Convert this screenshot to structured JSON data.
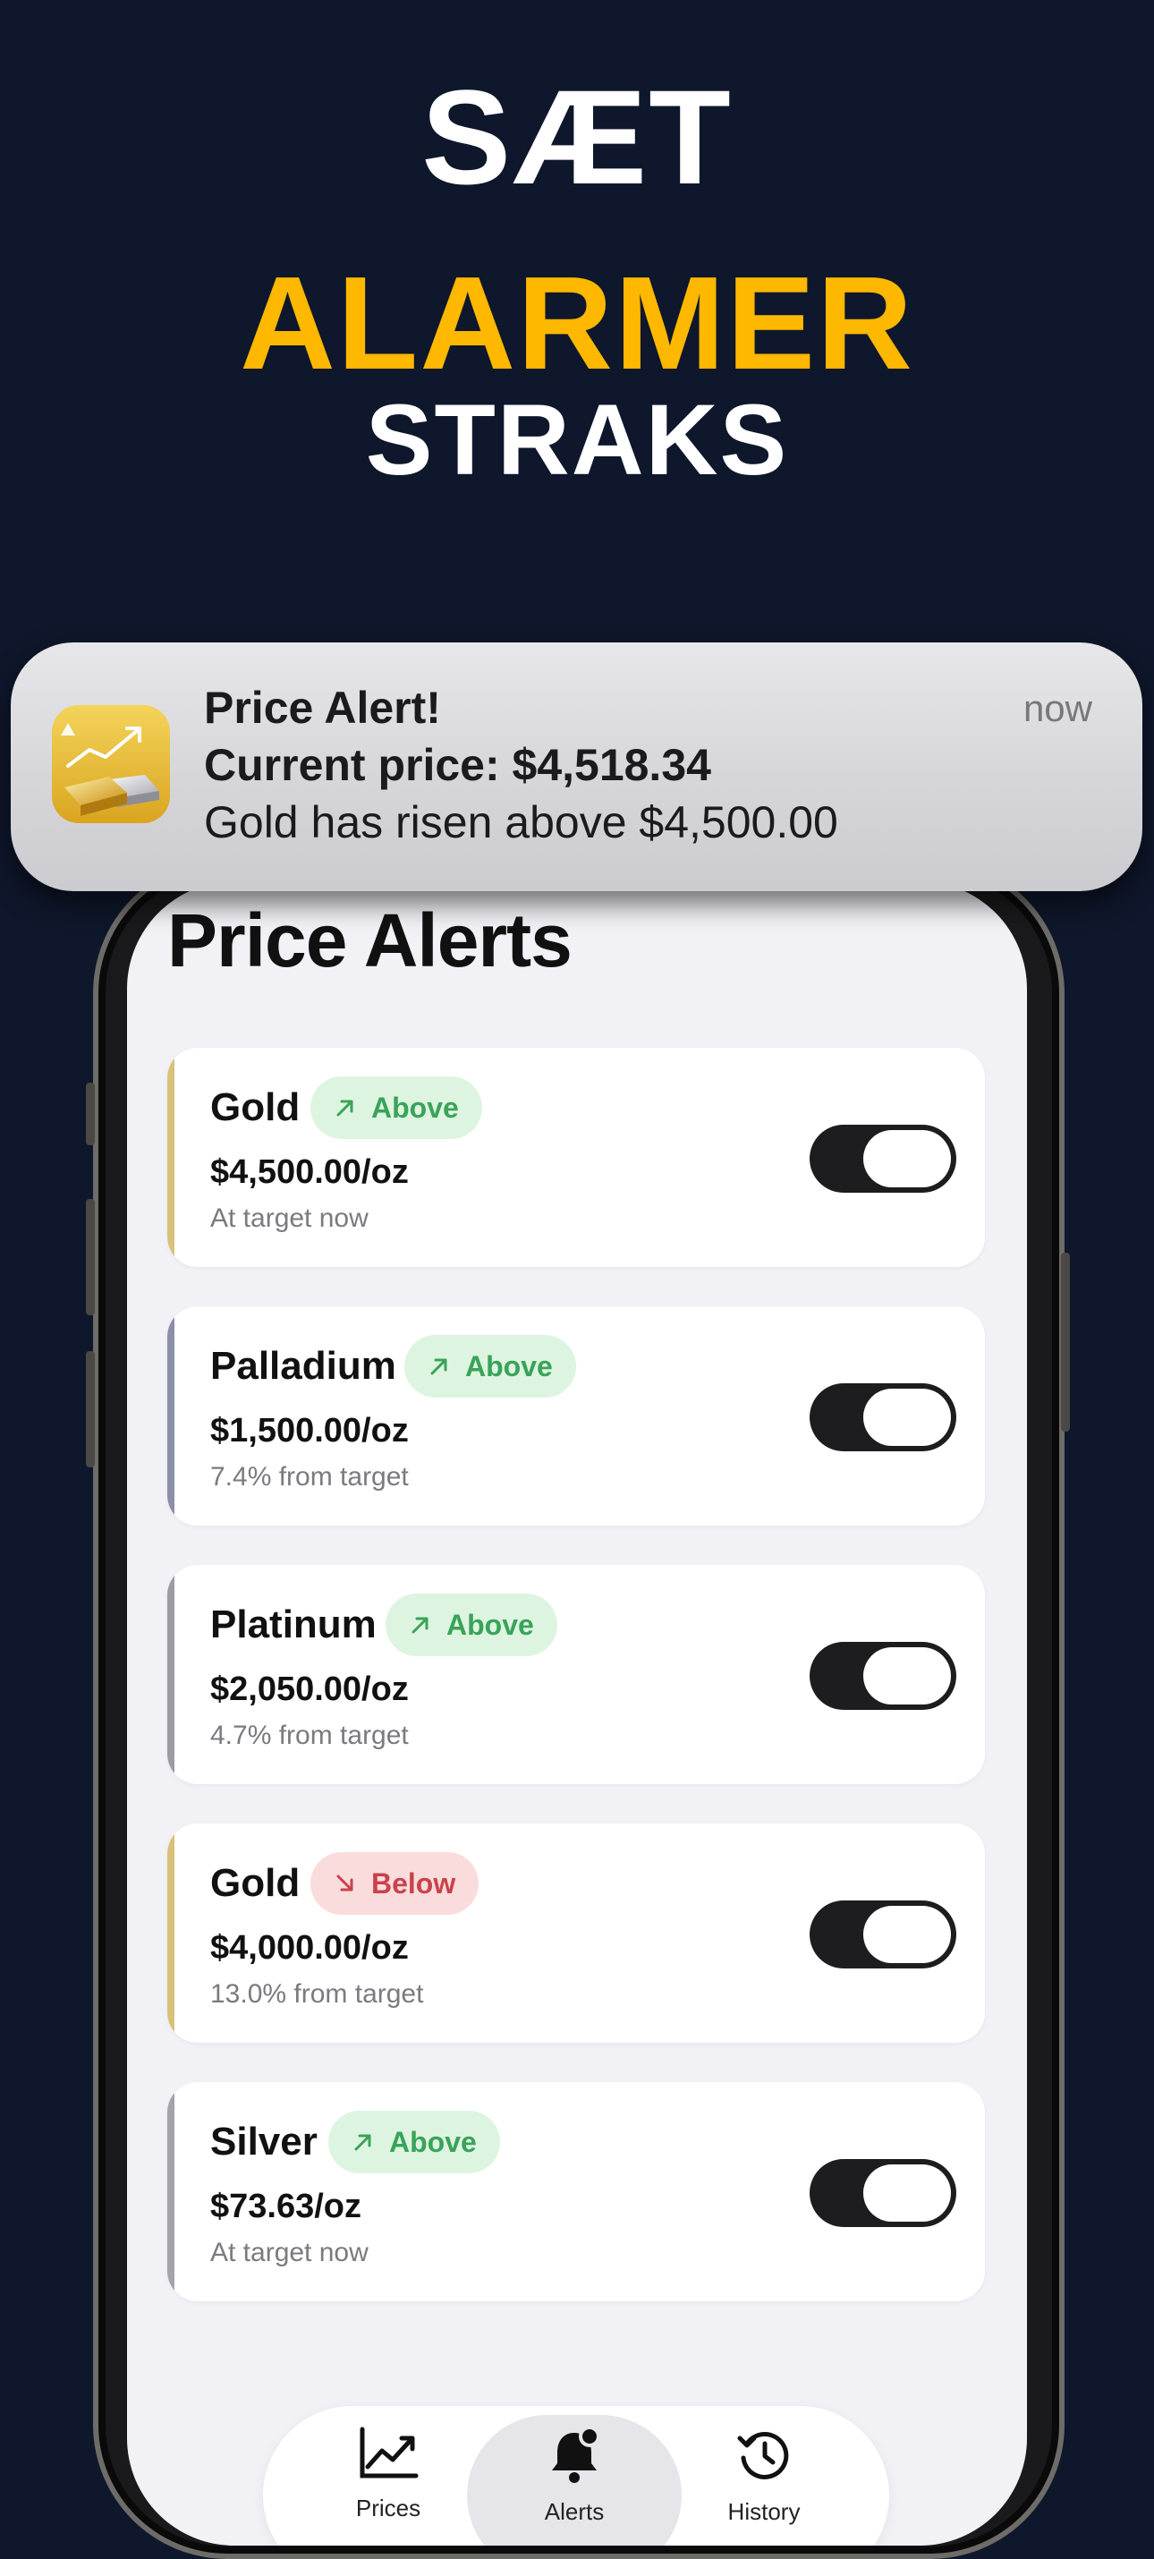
{
  "headline": {
    "line1": "SÆT",
    "line2": "ALARMER",
    "line3": "STRAKS"
  },
  "notification": {
    "title": "Price Alert!",
    "line1": "Current price: $4,518.34",
    "line2": "Gold has risen above $4,500.00",
    "time": "now",
    "icon": "gold-bars-app-icon"
  },
  "page": {
    "title": "Price Alerts"
  },
  "alerts": [
    {
      "metal": "Gold",
      "direction": "Above",
      "price": "$4,500.00/oz",
      "status": "At target now",
      "enabled": true,
      "accent": "#d8c27a"
    },
    {
      "metal": "Palladium",
      "direction": "Above",
      "price": "$1,500.00/oz",
      "status": "7.4% from target",
      "enabled": true,
      "accent": "#8b8fa8"
    },
    {
      "metal": "Platinum",
      "direction": "Above",
      "price": "$2,050.00/oz",
      "status": "4.7% from target",
      "enabled": true,
      "accent": "#9a9ba5"
    },
    {
      "metal": "Gold",
      "direction": "Below",
      "price": "$4,000.00/oz",
      "status": "13.0% from target",
      "enabled": true,
      "accent": "#d8c27a"
    },
    {
      "metal": "Silver",
      "direction": "Above",
      "price": "$73.63/oz",
      "status": "At target now",
      "enabled": true,
      "accent": "#a3a3ab"
    }
  ],
  "tabbar": {
    "tabs": [
      {
        "icon": "chart-icon",
        "label": "Prices"
      },
      {
        "icon": "bell-icon",
        "label": "Alerts"
      },
      {
        "icon": "history-icon",
        "label": "History"
      }
    ],
    "active": "Alerts"
  },
  "colors": {
    "background": "#0e172b",
    "accent_yellow": "#ffb800",
    "above_text": "#3aa35a",
    "below_text": "#c8434d"
  }
}
